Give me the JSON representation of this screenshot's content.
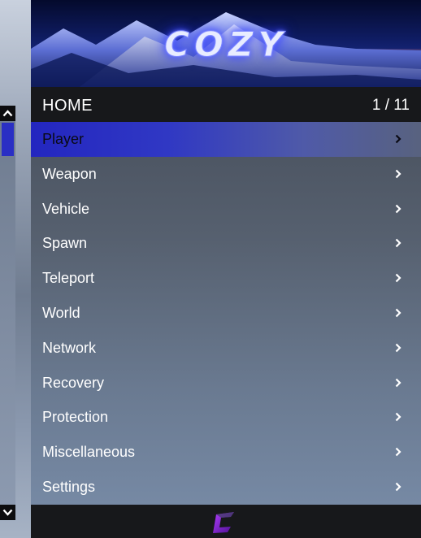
{
  "banner": {
    "title": "COZY"
  },
  "header": {
    "title": "HOME",
    "counter": "1 / 11"
  },
  "menu": {
    "items": [
      {
        "label": "Player",
        "selected": true
      },
      {
        "label": "Weapon"
      },
      {
        "label": "Vehicle"
      },
      {
        "label": "Spawn"
      },
      {
        "label": "Teleport"
      },
      {
        "label": "World"
      },
      {
        "label": "Network"
      },
      {
        "label": "Recovery"
      },
      {
        "label": "Protection"
      },
      {
        "label": "Miscellaneous"
      },
      {
        "label": "Settings"
      }
    ]
  },
  "scrollbar": {
    "position": 0.0
  },
  "colors": {
    "accent": "#2a2fc4",
    "header_bg": "#17181b",
    "logo": "#7a1fd0"
  },
  "icons": {
    "item_arrow": "chevron-right-icon",
    "scroll_up": "chevron-up-icon",
    "scroll_down": "chevron-down-icon",
    "footer": "cozy-logo-icon"
  }
}
